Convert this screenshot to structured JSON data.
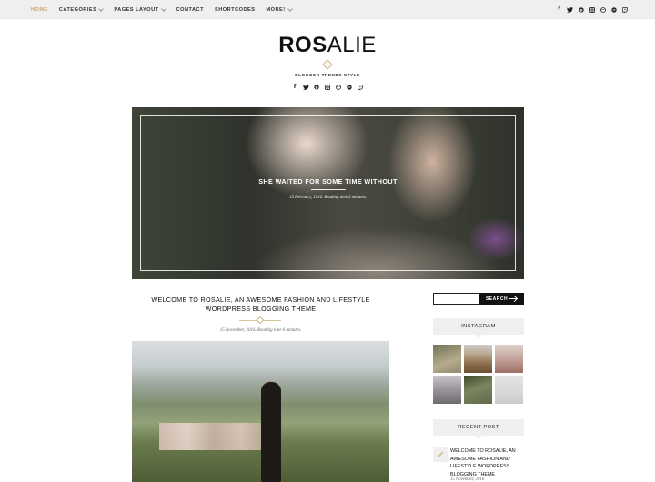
{
  "nav": {
    "items": [
      {
        "label": "HOME",
        "active": true,
        "dropdown": false
      },
      {
        "label": "CATEGORIES",
        "active": false,
        "dropdown": true
      },
      {
        "label": "PAGES LAYOUT",
        "active": false,
        "dropdown": true
      },
      {
        "label": "CONTACT",
        "active": false,
        "dropdown": false
      },
      {
        "label": "SHORTCODES",
        "active": false,
        "dropdown": false
      },
      {
        "label": "MORE!",
        "active": false,
        "dropdown": true
      }
    ],
    "social_icons": [
      "facebook-icon",
      "twitter-icon",
      "pinterest-icon",
      "instagram-icon",
      "dribbble-icon",
      "spotify-icon",
      "twitch-icon"
    ]
  },
  "site": {
    "logo_bold": "ROS",
    "logo_light": "ALIE",
    "tagline": "BLOGGER TRENDS STYLE",
    "social_icons": [
      "facebook-icon",
      "twitter-icon",
      "pinterest-icon",
      "instagram-icon",
      "dribbble-icon",
      "spotify-icon",
      "twitch-icon"
    ]
  },
  "hero": {
    "title": "SHE WAITED FOR SOME TIME WITHOUT",
    "meta": "15 February, 2016.  Reading time 2 minutes."
  },
  "post": {
    "title": "WELCOME TO ROSALIE, AN AWESOME FASHION AND LIFESTYLE WORDPRESS BLOGGING THEME",
    "meta": "15 November, 2016.  Reading time 6 minutes."
  },
  "sidebar": {
    "search_button": "SEARCH",
    "instagram_title": "INSTAGRAM",
    "recent_title": "RECENT POST",
    "recent_post": {
      "title": "WELCOME TO ROSALIE, AN AWESOME FASHION AND LIFESTYLE WORDPRESS BLOGGING THEME",
      "date": "15 November, 2016"
    },
    "instagram_colors": [
      "#8f8a72",
      "#8a6a4a",
      "#9c6e66",
      "#6f6a6f",
      "#5f6a4a",
      "#c9c9cc"
    ]
  },
  "colors": {
    "accent": "#c9a56a",
    "topbar": "#efefef",
    "dark": "#111111"
  }
}
